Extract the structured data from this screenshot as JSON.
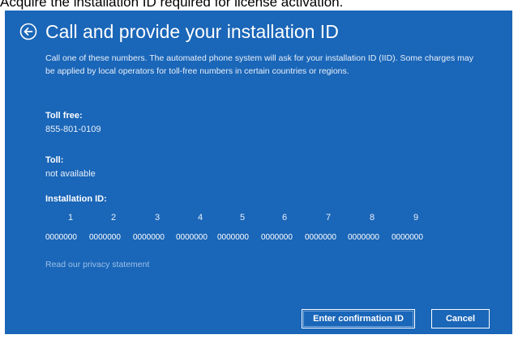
{
  "caption": "Acquire the installation ID required for license activation.",
  "dialog": {
    "title": "Call and provide your installation ID",
    "description": "Call one of these numbers. The automated phone system will ask for your installation ID (IID). Some charges may be applied by local operators for toll-free numbers in certain countries or regions.",
    "toll_free_label": "Toll free:",
    "toll_free_value": "855-801-0109",
    "toll_label": "Toll:",
    "toll_value": "not available",
    "installation_id_label": "Installation ID:",
    "iid_columns": [
      "1",
      "2",
      "3",
      "4",
      "5",
      "6",
      "7",
      "8",
      "9"
    ],
    "iid_groups": [
      "0000000",
      "0000000",
      "0000000",
      "0000000",
      "0000000",
      "0000000",
      "0000000",
      "0000000",
      "0000000"
    ],
    "privacy_link": "Read our privacy statement",
    "confirm_button": "Enter confirmation ID",
    "cancel_button": "Cancel"
  },
  "colors": {
    "panel_bg": "#1a66b8",
    "text": "#ffffff",
    "link": "#9cc0ea"
  },
  "icons": {
    "back": "back-arrow-circle-icon"
  }
}
